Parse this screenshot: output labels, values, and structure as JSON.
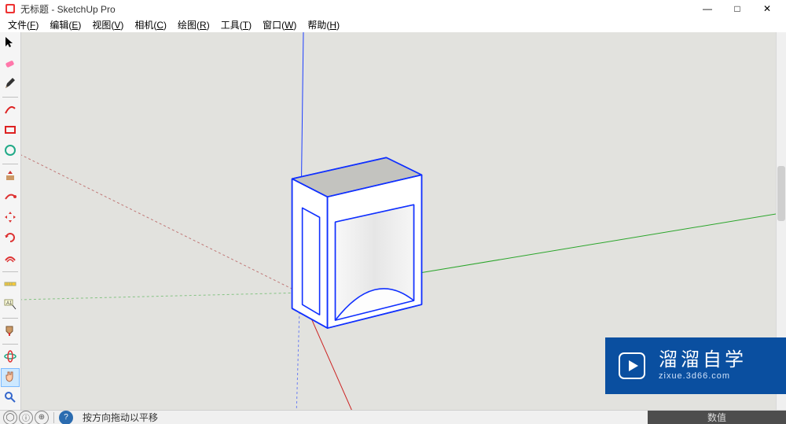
{
  "title": "无标题 - SketchUp Pro",
  "menus": [
    {
      "label": "文件",
      "accel": "F"
    },
    {
      "label": "编辑",
      "accel": "E"
    },
    {
      "label": "视图",
      "accel": "V"
    },
    {
      "label": "相机",
      "accel": "C"
    },
    {
      "label": "绘图",
      "accel": "R"
    },
    {
      "label": "工具",
      "accel": "T"
    },
    {
      "label": "窗口",
      "accel": "W"
    },
    {
      "label": "帮助",
      "accel": "H"
    }
  ],
  "win_controls": {
    "min": "—",
    "max": "□",
    "close": "✕"
  },
  "tools": [
    {
      "name": "select-tool",
      "kind": "arrow"
    },
    {
      "name": "eraser-tool",
      "kind": "eraser"
    },
    {
      "name": "line-tool",
      "kind": "pencil"
    },
    {
      "name": "sep"
    },
    {
      "name": "arc-tool",
      "kind": "arc"
    },
    {
      "name": "rectangle-tool",
      "kind": "rect"
    },
    {
      "name": "circle-tool",
      "kind": "circle"
    },
    {
      "name": "sep"
    },
    {
      "name": "pushpull-tool",
      "kind": "pushpull"
    },
    {
      "name": "followme-tool",
      "kind": "follow"
    },
    {
      "name": "move-tool",
      "kind": "move"
    },
    {
      "name": "rotate-tool",
      "kind": "rotate"
    },
    {
      "name": "offset-tool",
      "kind": "offset"
    },
    {
      "name": "sep"
    },
    {
      "name": "tape-tool",
      "kind": "tape"
    },
    {
      "name": "text-tool",
      "kind": "text"
    },
    {
      "name": "sep"
    },
    {
      "name": "paint-tool",
      "kind": "paint"
    },
    {
      "name": "sep"
    },
    {
      "name": "orbit-tool",
      "kind": "orbit"
    },
    {
      "name": "pan-tool",
      "kind": "pan",
      "active": true
    },
    {
      "name": "zoom-tool",
      "kind": "zoom"
    }
  ],
  "status_hint": "按方向拖动以平移",
  "status_right": "数值",
  "watermark": {
    "cn": "溜溜自学",
    "en": "zixue.3d66.com"
  }
}
